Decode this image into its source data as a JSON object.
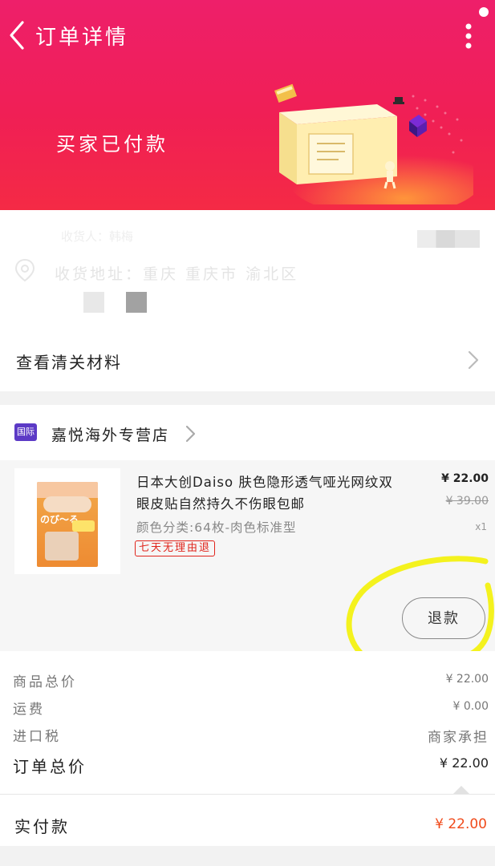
{
  "nav": {
    "title": "订单详情"
  },
  "status": {
    "text": "买家已付款"
  },
  "address": {
    "name_line": "收货人：韩梅",
    "line": "收货地址：重庆 重庆市 渝北区"
  },
  "customs": {
    "label": "查看清关材料"
  },
  "store": {
    "badge": "国际",
    "name": "嘉悦海外专营店"
  },
  "product": {
    "title": "日本大创Daiso 肤色隐形透气哑光网纹双眼皮贴自然持久不伤眼包邮",
    "sku": "颜色分类:64枚-肉色标准型",
    "tag": "七天无理由退",
    "price": "¥ 22.00",
    "original_price": "¥ 39.00",
    "quantity": "x1",
    "package_brand": "のび〜る",
    "refund_label": "退款"
  },
  "summary": {
    "goods_label": "商品总价",
    "goods_value": "¥ 22.00",
    "shipping_label": "运费",
    "shipping_value": "¥ 0.00",
    "tax_label": "进口税",
    "tax_value": "商家承担",
    "total_label": "订单总价",
    "total_value": "¥ 22.00"
  },
  "paid": {
    "label": "实付款",
    "value": "¥ 22.00"
  },
  "colors": {
    "header": "#f01f55",
    "accent_red": "#e0241b",
    "paid_orange": "#f04a1a",
    "highlight": "#f4f21e"
  }
}
